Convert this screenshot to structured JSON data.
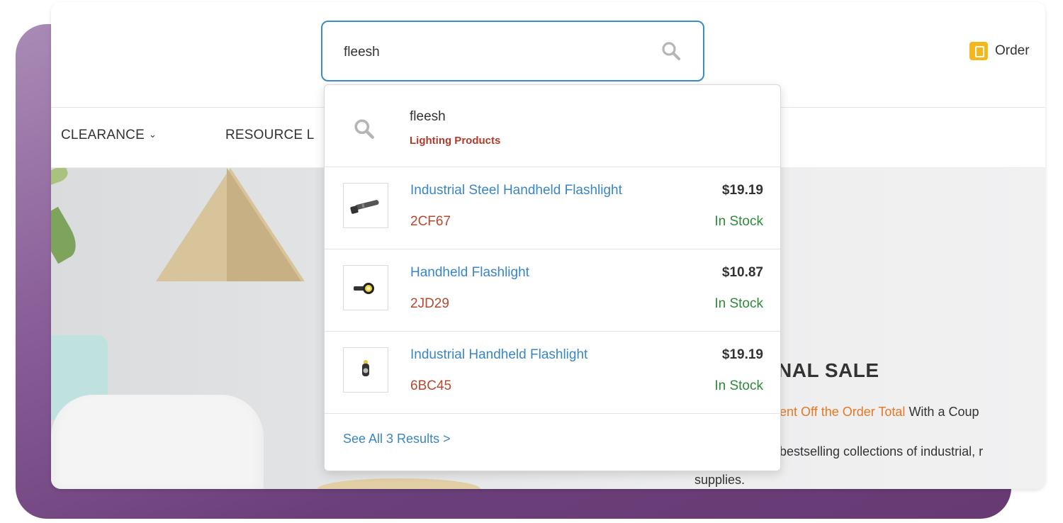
{
  "search": {
    "value": "fleesh",
    "placeholder": ""
  },
  "header": {
    "orders_label": "Order"
  },
  "nav": {
    "items": [
      {
        "label": "CLEARANCE",
        "has_dropdown": true
      },
      {
        "label": "RESOURCE L",
        "has_dropdown": false
      }
    ]
  },
  "dropdown": {
    "suggestion": {
      "term": "fleesh",
      "category": "Lighting Products"
    },
    "results": [
      {
        "name": "Industrial Steel Handheld Flashlight",
        "sku": "2CF67",
        "price": "$19.19",
        "stock": "In Stock"
      },
      {
        "name": "Handheld Flashlight",
        "sku": "2JD29",
        "price": "$10.87",
        "stock": "In Stock"
      },
      {
        "name": "Industrial Handheld Flashlight",
        "sku": "6BC45",
        "price": "$19.19",
        "stock": "In Stock"
      }
    ],
    "see_all": "See All 3 Results >"
  },
  "hero": {
    "sale_title": "NAL SALE",
    "promo_highlight": "ent Off the Order Total",
    "promo_rest": " With a Coup",
    "desc_line1": "bestselling collections of industrial, r",
    "desc_line2": "supplies."
  },
  "colors": {
    "accent_blue": "#3a86c2",
    "sku_red": "#b5492e",
    "stock_green": "#2f8a3b",
    "category_red": "#b13a2b",
    "promo_orange": "#e87722",
    "orders_yellow": "#f5b81c",
    "backdrop_purple": "#6b3f79"
  },
  "icons": {
    "search": "search-icon",
    "orders": "orders-icon",
    "chevron": "chevron-down-icon"
  }
}
